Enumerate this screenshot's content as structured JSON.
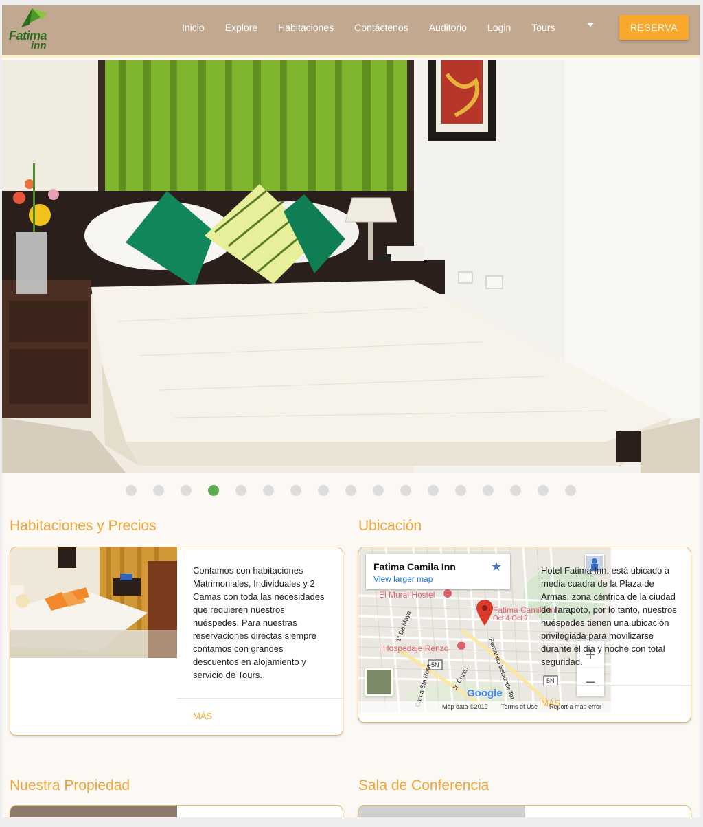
{
  "brand": {
    "name_line1": "Fatima",
    "name_line2": "inn"
  },
  "nav": {
    "links": [
      "Inicio",
      "Explore",
      "Habitaciones",
      "Contáctenos",
      "Auditorio",
      "Login",
      "Tours"
    ],
    "reserve_label": "RESERVA"
  },
  "slider": {
    "dot_count": 17,
    "active_index": 3
  },
  "sections": {
    "rooms": {
      "title": "Habitaciones y Precios",
      "text": "Contamos con habitaciones Matrimoniales, Individuales y 2 Camas con toda las necesidades que requieren nuestros huéspedes. Para nuestras reservaciones directas siempre contamos con grandes descuentos en alojamiento y servicio de Tours.",
      "more_label": "MÁS"
    },
    "location": {
      "title": "Ubicación",
      "text": "Hotel Fatima Inn. está ubicado a media cuadra de la Plaza de Armas, zona céntrica de la ciudad de Tarapoto, por lo tanto, nuestros huéspedes tienen una ubicación privilegiada para movilizarse durante el dia y noche con total seguridad.",
      "more_label": "MÁS",
      "map": {
        "place_name": "Fatima Camila Inn",
        "larger_map_label": "View larger map",
        "marker_label": "Fatima Camila Inn",
        "marker_dates": "Oct 4-Oct 7",
        "poi_1": "El Mural Hostel",
        "poi_2": "Hospedaje Renzo",
        "street_1": "1° De Mayo",
        "street_2": "Jr. Cuzco",
        "street_3": "Carr a Sta Rosa",
        "street_4": "Fernando Belaunde Ter",
        "route_1": "5N",
        "route_2": "5N",
        "google_label": "Google",
        "map_data": "Map data ©2019",
        "terms": "Terms of Use",
        "report": "Report a map error",
        "zoom_in": "+",
        "zoom_out": "−"
      }
    },
    "property": {
      "title": "Nuestra Propiedad"
    },
    "conference": {
      "title": "Sala de Conferencia"
    }
  },
  "colors": {
    "navbar": "#c1a991",
    "accent": "#f7a82d",
    "title": "#f1a438",
    "active_dot": "#5bab50"
  },
  "icons": {
    "logo": "leaf-logo-icon",
    "caret": "chevron-down-icon",
    "star": "star-icon",
    "marker": "map-pin-icon",
    "pegman": "street-view-icon"
  }
}
